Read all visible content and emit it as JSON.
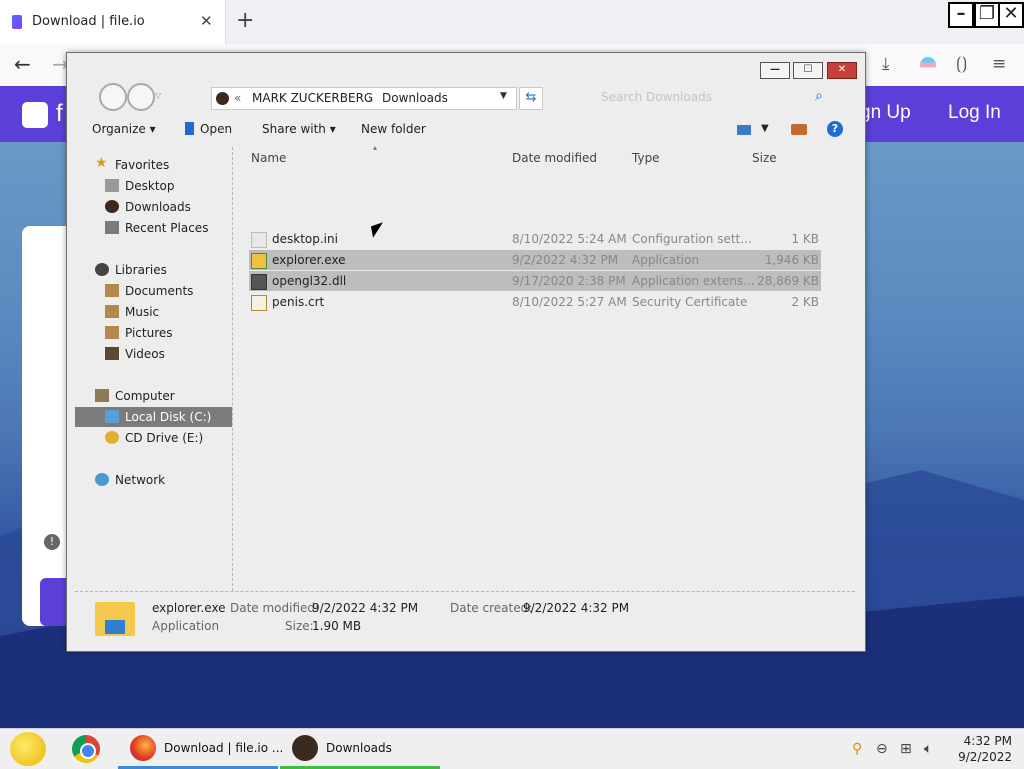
{
  "browser": {
    "tab_title": "Download | file.io",
    "new_tab_symbol": "+",
    "tab_close_symbol": "✕"
  },
  "site": {
    "logo_letter": "f",
    "signup": "gn Up",
    "login": "Log In",
    "info_symbol": "!"
  },
  "explorer": {
    "address": {
      "prefix": "«",
      "crumb1": "MARK ZUCKERBERG",
      "sep": "›",
      "crumb2": "Downloads"
    },
    "search_placeholder": "Search Downloads",
    "toolbar": {
      "organize": "Organize",
      "open": "Open",
      "share": "Share with",
      "new_folder": "New folder"
    },
    "nav": {
      "favorites": "Favorites",
      "desktop": "Desktop",
      "downloads": "Downloads",
      "recent": "Recent Places",
      "libraries": "Libraries",
      "documents": "Documents",
      "music": "Music",
      "pictures": "Pictures",
      "videos": "Videos",
      "computer": "Computer",
      "local_disk": "Local Disk (C:)",
      "cd_drive": "CD Drive (E:)",
      "network": "Network"
    },
    "columns": {
      "name": "Name",
      "date": "Date modified",
      "type": "Type",
      "size": "Size"
    },
    "files": [
      {
        "name": "desktop.ini",
        "date": "8/10/2022 5:24 AM",
        "type": "Configuration sett...",
        "size": "1 KB"
      },
      {
        "name": "explorer.exe",
        "date": "9/2/2022 4:32 PM",
        "type": "Application",
        "size": "1,946 KB"
      },
      {
        "name": "opengl32.dll",
        "date": "9/17/2020 2:38 PM",
        "type": "Application extens...",
        "size": "28,869 KB"
      },
      {
        "name": "penis.crt",
        "date": "8/10/2022 5:27 AM",
        "type": "Security Certificate",
        "size": "2 KB"
      }
    ],
    "details": {
      "filename": "explorer.exe",
      "filetype": "Application",
      "modified_label": "Date modified:",
      "modified": "9/2/2022 4:32 PM",
      "created_label": "Date created:",
      "created": "9/2/2022 4:32 PM",
      "size_label": "Size:",
      "size": "1.90 MB"
    }
  },
  "taskbar": {
    "firefox_task": "Download | file.io ...",
    "explorer_task": "Downloads",
    "time": "4:32 PM",
    "date": "9/2/2022"
  }
}
